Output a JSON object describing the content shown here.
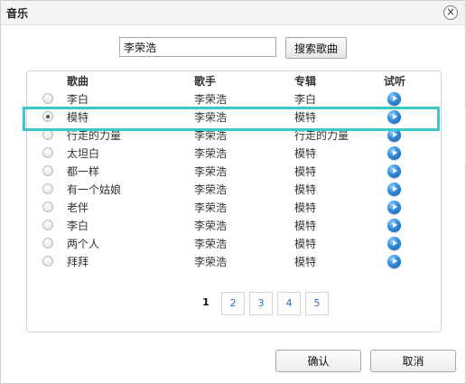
{
  "dialog": {
    "title": "音乐",
    "close_label": "×"
  },
  "search": {
    "value": "李荣浩",
    "button_label": "搜索歌曲"
  },
  "table": {
    "headers": [
      "歌曲",
      "歌手",
      "专辑",
      "试听"
    ],
    "selected_index": 1,
    "rows": [
      {
        "song": "李白",
        "artist": "李荣浩",
        "album": "李白"
      },
      {
        "song": "模特",
        "artist": "李荣浩",
        "album": "模特"
      },
      {
        "song": "行走的力量",
        "artist": "李荣浩",
        "album": "行走的力量"
      },
      {
        "song": "太坦白",
        "artist": "李荣浩",
        "album": "模特"
      },
      {
        "song": "都一样",
        "artist": "李荣浩",
        "album": "模特"
      },
      {
        "song": "有一个姑娘",
        "artist": "李荣浩",
        "album": "模特"
      },
      {
        "song": "老伴",
        "artist": "李荣浩",
        "album": "模特"
      },
      {
        "song": "李白",
        "artist": "李荣浩",
        "album": "模特"
      },
      {
        "song": "两个人",
        "artist": "李荣浩",
        "album": "模特"
      },
      {
        "song": "拜拜",
        "artist": "李荣浩",
        "album": "模特"
      }
    ]
  },
  "pagination": {
    "current": "1",
    "pages": [
      "2",
      "3",
      "4",
      "5"
    ]
  },
  "footer": {
    "confirm_label": "确认",
    "cancel_label": "取消"
  },
  "colors": {
    "highlight": "#3ac8c8",
    "play_icon": "#2f8bdc",
    "link": "#2a6fb5"
  },
  "icons": {
    "play": "play-circle-icon",
    "close": "close-circle-icon"
  }
}
